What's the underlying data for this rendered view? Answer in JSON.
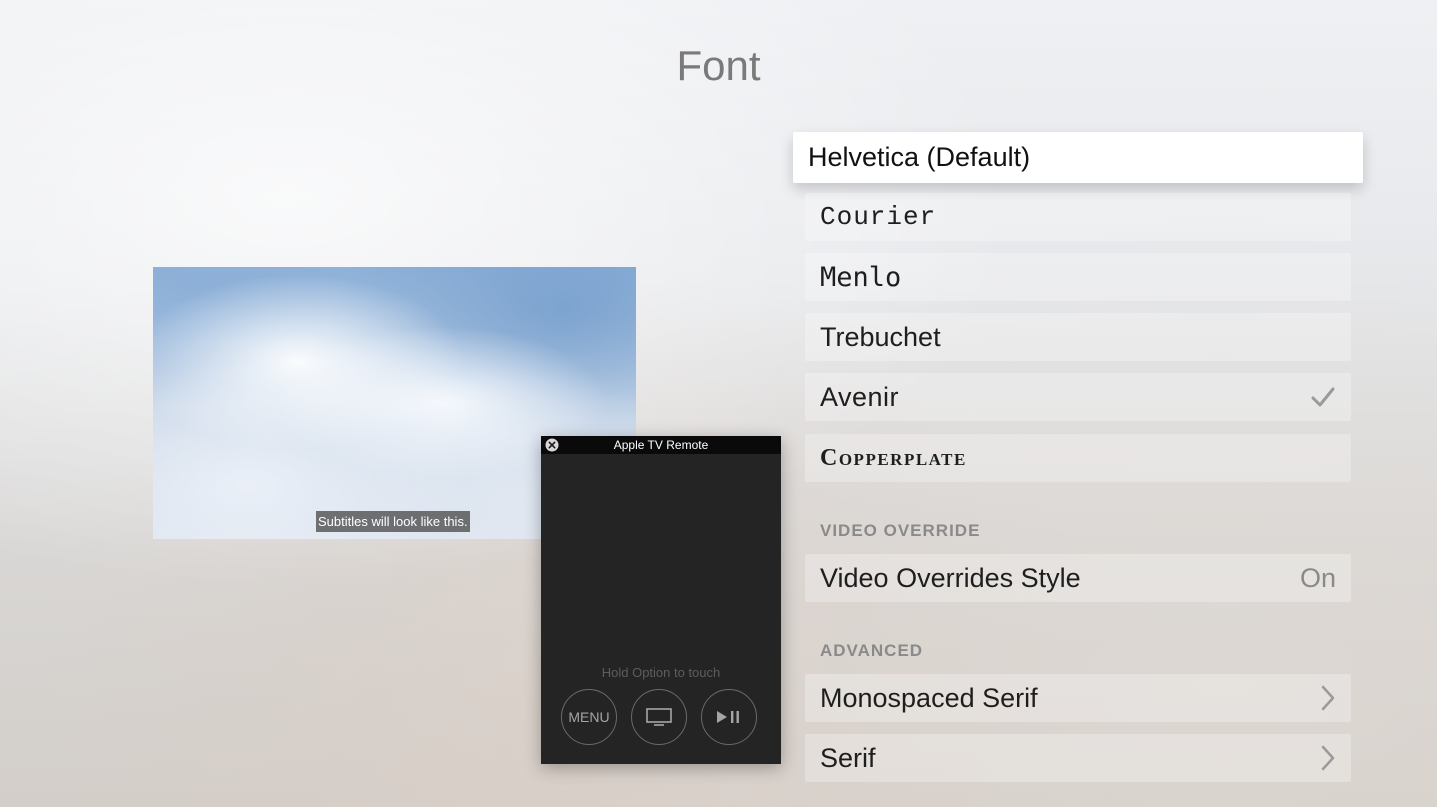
{
  "header": {
    "title": "Font"
  },
  "preview": {
    "subtitle_sample": "Subtitles will look like this."
  },
  "fonts": [
    {
      "label": "Helvetica (Default)"
    },
    {
      "label": "Courier"
    },
    {
      "label": "Menlo"
    },
    {
      "label": "Trebuchet"
    },
    {
      "label": "Avenir",
      "selected": true
    },
    {
      "label": "Copperplate"
    }
  ],
  "video_override": {
    "header": "VIDEO OVERRIDE",
    "item_label": "Video Overrides Style",
    "item_value": "On"
  },
  "advanced": {
    "header": "ADVANCED",
    "items": [
      {
        "label": "Monospaced Serif"
      },
      {
        "label": "Serif"
      }
    ]
  },
  "remote": {
    "title": "Apple TV Remote",
    "hint": "Hold Option to touch",
    "menu_label": "MENU",
    "tv_icon": "tv-icon",
    "play_pause_icon": "play-pause-icon"
  }
}
